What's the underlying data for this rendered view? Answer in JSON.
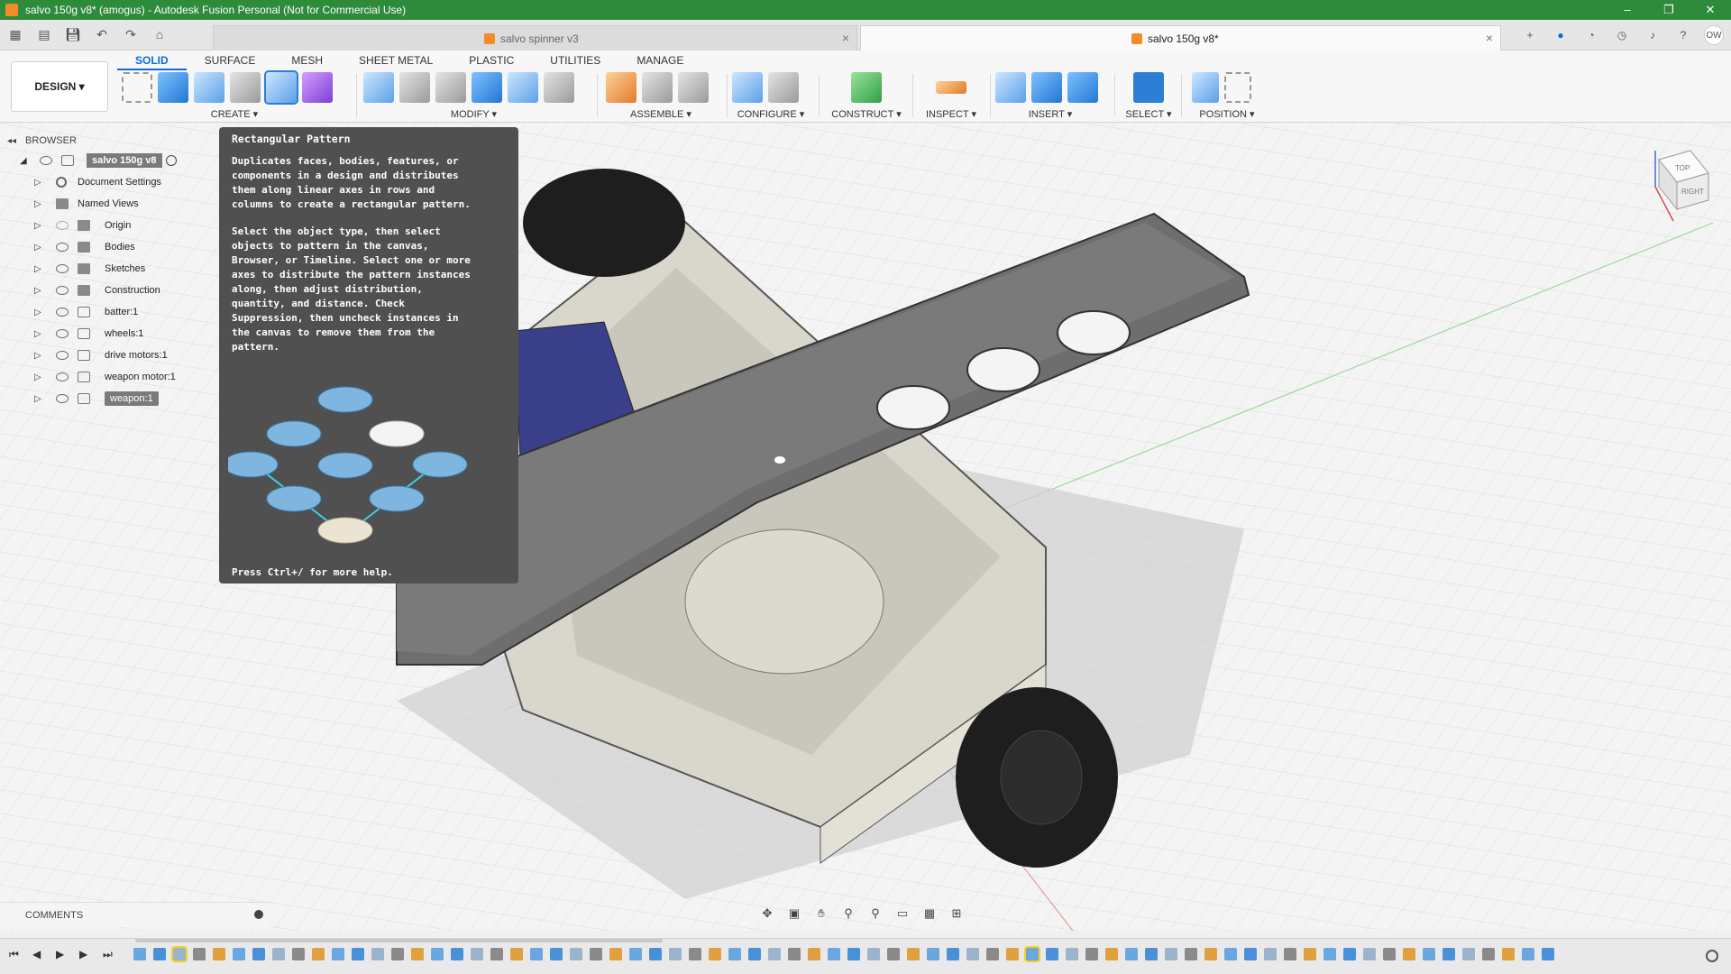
{
  "window": {
    "title": "salvo 150g v8* (amogus) - Autodesk Fusion Personal (Not for Commercial Use)",
    "controls": [
      "–",
      "❐",
      "✕"
    ]
  },
  "tabs": [
    {
      "label": "salvo spinner v3",
      "active": false
    },
    {
      "label": "salvo 150g v8*",
      "active": true
    }
  ],
  "user_initials": "OW",
  "workspace": {
    "design_label": "DESIGN ▾",
    "tabs": [
      "SOLID",
      "SURFACE",
      "MESH",
      "SHEET METAL",
      "PLASTIC",
      "UTILITIES",
      "MANAGE"
    ]
  },
  "toolbar_groups": [
    {
      "label": "CREATE ▾"
    },
    {
      "label": "MODIFY ▾"
    },
    {
      "label": "ASSEMBLE ▾"
    },
    {
      "label": "CONFIGURE ▾"
    },
    {
      "label": "CONSTRUCT ▾"
    },
    {
      "label": "INSPECT ▾"
    },
    {
      "label": "INSERT ▾"
    },
    {
      "label": "SELECT ▾"
    },
    {
      "label": "POSITION ▾"
    }
  ],
  "browser": {
    "header": "BROWSER",
    "root": "salvo 150g v8",
    "items": [
      {
        "label": "Document Settings",
        "icon": "gear-icon"
      },
      {
        "label": "Named Views",
        "icon": "folder-icon"
      },
      {
        "label": "Origin",
        "icon": "folder-icon"
      },
      {
        "label": "Bodies",
        "icon": "folder-icon"
      },
      {
        "label": "Sketches",
        "icon": "folder-icon"
      },
      {
        "label": "Construction",
        "icon": "folder-icon"
      },
      {
        "label": "batter:1",
        "icon": "component-icon"
      },
      {
        "label": "wheels:1",
        "icon": "component-icon"
      },
      {
        "label": "drive motors:1",
        "icon": "component-icon"
      },
      {
        "label": "weapon motor:1",
        "icon": "component-icon"
      },
      {
        "label": "weapon:1",
        "icon": "component-icon",
        "selected": true
      }
    ]
  },
  "tooltip": {
    "title": "Rectangular Pattern",
    "para1": "Duplicates faces, bodies, features, or\ncomponents in a design and distributes\nthem along linear axes in rows and\ncolumns to create a rectangular pattern.",
    "para2": "Select the object type, then select\nobjects to pattern in the canvas,\nBrowser, or Timeline. Select one or more\naxes to distribute the pattern instances\nalong, then adjust distribution,\nquantity, and distance. Check\nSuppression, then uncheck instances in\nthe canvas to remove them from the\npattern.",
    "footer": "Press Ctrl+/ for more help."
  },
  "viewcube": {
    "top": "TOP",
    "right": "RIGHT"
  },
  "comments": {
    "label": "COMMENTS"
  },
  "colors": {
    "titlebar": "#2e8b3b",
    "accent": "#0a6cd6",
    "tooltip_bg": "#505050",
    "model_body": "#d9d6cc",
    "weapon_bar": "#6e6e6e",
    "tire": "#1e1e1e",
    "battery": "#3a3f8a"
  }
}
